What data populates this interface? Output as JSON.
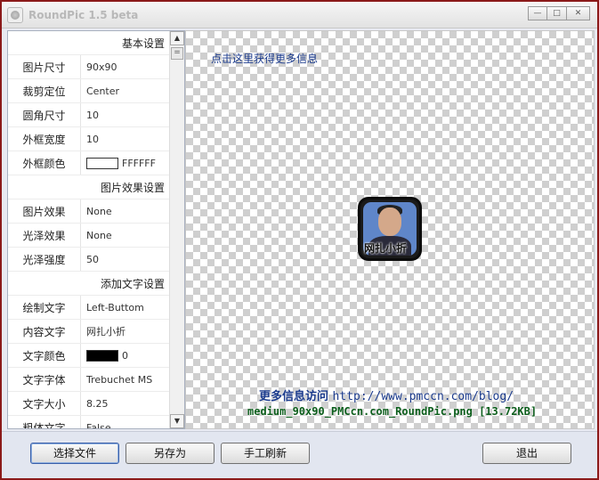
{
  "window": {
    "title": "RoundPic 1.5 beta"
  },
  "controls": {
    "minimize": "—",
    "restore": "□",
    "close": "✕"
  },
  "properties": {
    "rows": [
      {
        "type": "section",
        "label": "基本设置"
      },
      {
        "type": "prop",
        "key": "图片尺寸",
        "value": "90x90"
      },
      {
        "type": "prop",
        "key": "裁剪定位",
        "value": "Center"
      },
      {
        "type": "prop",
        "key": "圆角尺寸",
        "value": "10"
      },
      {
        "type": "prop",
        "key": "外框宽度",
        "value": "10"
      },
      {
        "type": "prop",
        "key": "外框颜色",
        "value": "FFFFFF",
        "swatch": "#ffffff"
      },
      {
        "type": "section",
        "label": "图片效果设置"
      },
      {
        "type": "prop",
        "key": "图片效果",
        "value": "None"
      },
      {
        "type": "prop",
        "key": "光泽效果",
        "value": "None"
      },
      {
        "type": "prop",
        "key": "光泽强度",
        "value": "50"
      },
      {
        "type": "section",
        "label": "添加文字设置"
      },
      {
        "type": "prop",
        "key": "绘制文字",
        "value": "Left-Buttom"
      },
      {
        "type": "prop",
        "key": "内容文字",
        "value": "网扎小折"
      },
      {
        "type": "prop",
        "key": "文字颜色",
        "value": "0",
        "swatch": "#000000"
      },
      {
        "type": "prop",
        "key": "文字字体",
        "value": "Trebuchet MS"
      },
      {
        "type": "prop",
        "key": "文字大小",
        "value": "8.25"
      },
      {
        "type": "prop",
        "key": "粗体文字",
        "value": "False"
      }
    ]
  },
  "preview": {
    "info_link": "点击这里获得更多信息",
    "thumb_text": "网扎小折",
    "visit_label": "更多信息访问",
    "visit_url": "http://www.pmccn.com/blog/",
    "file_info": "medium_90x90_PMCcn.com_RoundPic.png [13.72KB]"
  },
  "buttons": {
    "open": "选择文件",
    "save_as": "另存为",
    "refresh": "手工刷新",
    "exit": "退出"
  },
  "colors": {
    "link": "#1a3a8c",
    "file_info": "#0c5e1c",
    "window_border": "#8b1a1a"
  }
}
